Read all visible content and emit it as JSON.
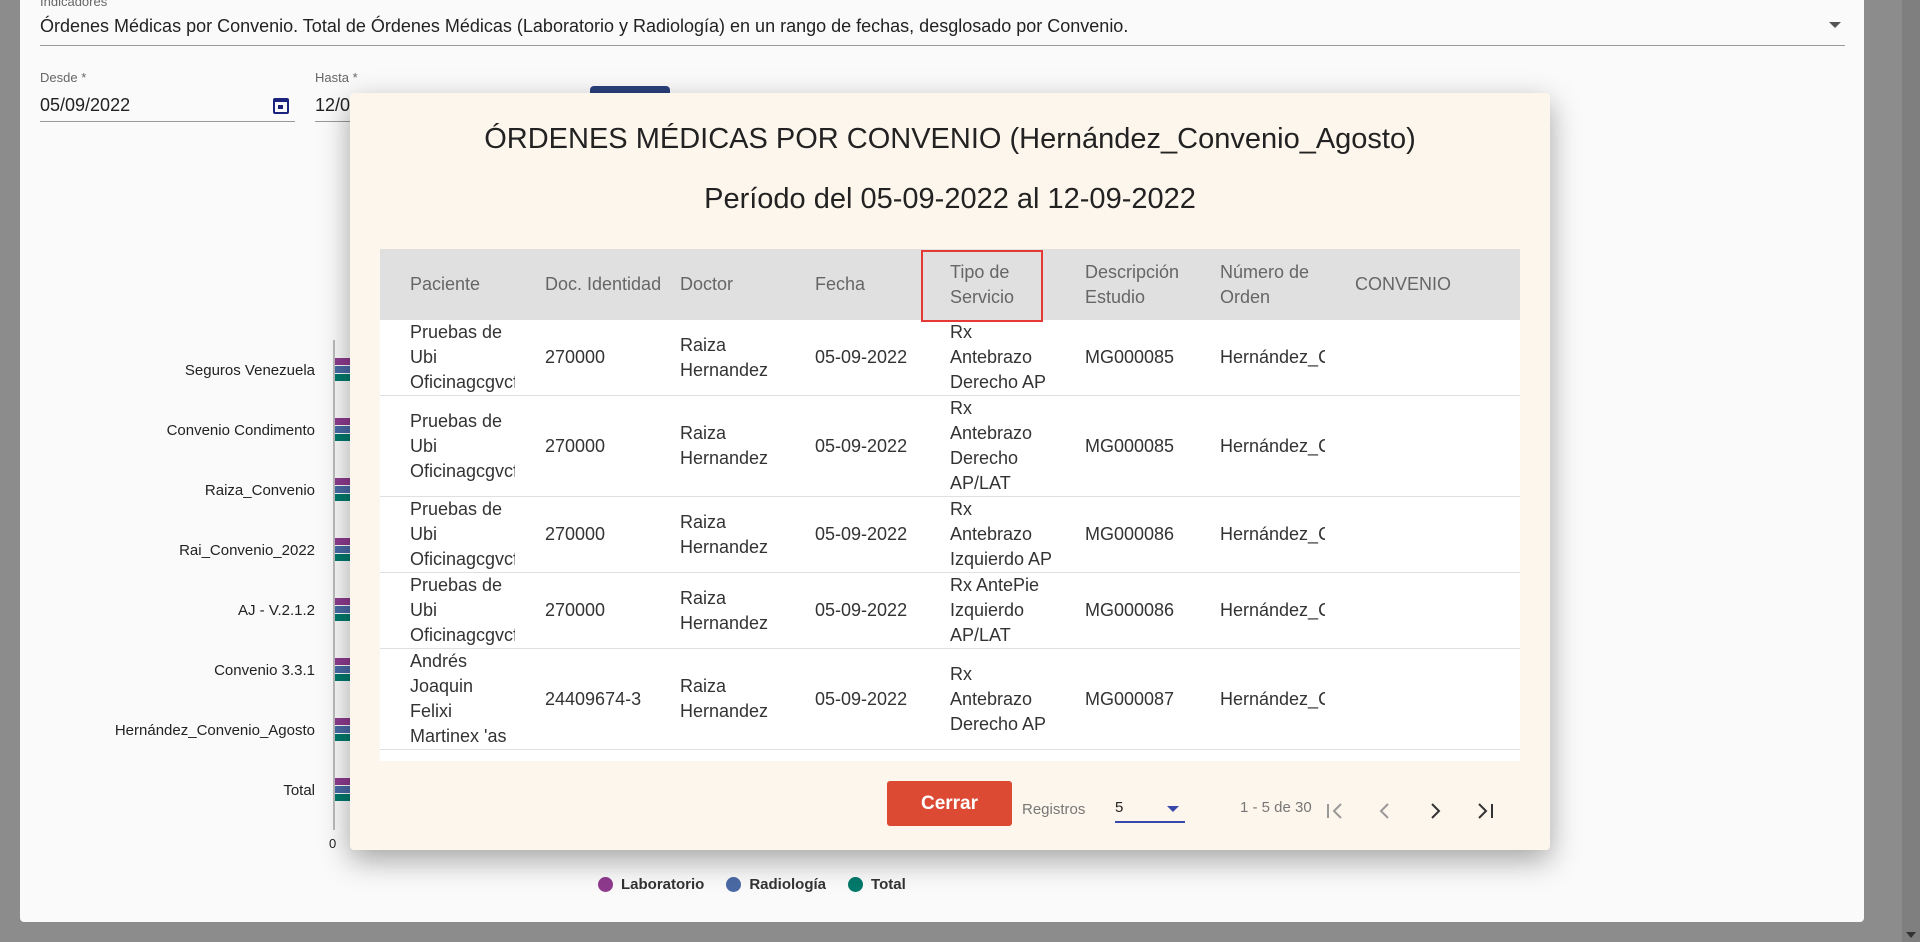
{
  "background": {
    "indicator_label": "Indicadores",
    "indicator_value": "Órdenes Médicas por Convenio. Total de Órdenes Médicas (Laboratorio y Radiología) en un rango de fechas, desglosado por Convenio.",
    "desde_label": "Desde *",
    "desde_value": "05/09/2022",
    "hasta_label": "Hasta *",
    "hasta_value": "12/0",
    "chart": {
      "categories": [
        "Seguros Venezuela",
        "Convenio Condimento",
        "Raiza_Convenio",
        "Rai_Convenio_2022",
        "AJ - V.2.1.2",
        "Convenio 3.3.1",
        "Hernández_Convenio_Agosto",
        "Total"
      ],
      "zero_tick": "0",
      "legend": [
        {
          "label": "Laboratorio",
          "color": "#8e3a8e"
        },
        {
          "label": "Radiología",
          "color": "#4a6aa5"
        },
        {
          "label": "Total",
          "color": "#00796b"
        }
      ]
    }
  },
  "modal": {
    "title": "ÓRDENES MÉDICAS POR CONVENIO (Hernández_Convenio_Agosto)",
    "subtitle": "Período del 05-09-2022 al 12-09-2022",
    "columns": [
      "Paciente",
      "Doc. Identidad",
      "Doctor",
      "Fecha",
      "Tipo de Servicio",
      "Descripción Estudio",
      "Número de Orden",
      "CONVENIO"
    ],
    "rows": [
      {
        "paciente": "Pruebas de Ubi Oficinagcgvcfcg",
        "doc": "270000",
        "doctor": "Raiza Hernandez",
        "fecha": "05-09-2022",
        "tipo": "Rx Antebrazo Derecho AP",
        "desc": "MG000085",
        "orden": "Hernández_Convenio_Agosto",
        "convenio": ""
      },
      {
        "paciente": "Pruebas de Ubi Oficinagcgvcfcg",
        "doc": "270000",
        "doctor": "Raiza Hernandez",
        "fecha": "05-09-2022",
        "tipo": "Rx Antebrazo Derecho AP/LAT",
        "desc": "MG000085",
        "orden": "Hernández_Convenio_Agosto",
        "convenio": ""
      },
      {
        "paciente": "Pruebas de Ubi Oficinagcgvcfcg",
        "doc": "270000",
        "doctor": "Raiza Hernandez",
        "fecha": "05-09-2022",
        "tipo": "Rx Antebrazo Izquierdo AP",
        "desc": "MG000086",
        "orden": "Hernández_Convenio_Agosto",
        "convenio": ""
      },
      {
        "paciente": "Pruebas de Ubi Oficinagcgvcfcg",
        "doc": "270000",
        "doctor": "Raiza Hernandez",
        "fecha": "05-09-2022",
        "tipo": "Rx AntePie Izquierdo AP/LAT",
        "desc": "MG000086",
        "orden": "Hernández_Convenio_Agosto",
        "convenio": ""
      },
      {
        "paciente": "Andrés Joaquin Felixi Martinex 'as",
        "doc": "24409674-3",
        "doctor": "Raiza Hernandez",
        "fecha": "05-09-2022",
        "tipo": "Rx Antebrazo Derecho AP",
        "desc": "MG000087",
        "orden": "Hernández_Convenio_Agosto",
        "convenio": ""
      }
    ],
    "pagination": {
      "label": "Registros",
      "page_size": "5",
      "range": "1 - 5 de 30"
    },
    "close_label": "Cerrar"
  }
}
